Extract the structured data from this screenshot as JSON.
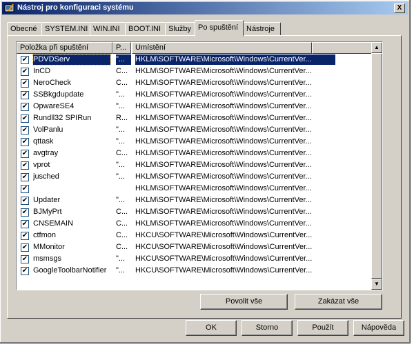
{
  "window": {
    "title": "Nástroj pro konfiguraci systému",
    "close_label": "X"
  },
  "tabs": [
    "Obecné",
    "SYSTEM.INI",
    "WIN.INI",
    "BOOT.INI",
    "Služby",
    "Po spuštění",
    "Nástroje"
  ],
  "active_tab": 5,
  "listview": {
    "headers": {
      "item": "Položka při spuštění",
      "command": "P...",
      "location": "Umístění"
    },
    "rows": [
      {
        "name": "PDVDServ",
        "command": "\"...",
        "location": "HKLM\\SOFTWARE\\Microsoft\\Windows\\CurrentVer...",
        "checked": true,
        "selected": true
      },
      {
        "name": "InCD",
        "command": "C...",
        "location": "HKLM\\SOFTWARE\\Microsoft\\Windows\\CurrentVer...",
        "checked": true
      },
      {
        "name": "NeroCheck",
        "command": "C...",
        "location": "HKLM\\SOFTWARE\\Microsoft\\Windows\\CurrentVer...",
        "checked": true
      },
      {
        "name": "SSBkgdupdate",
        "command": "\"...",
        "location": "HKLM\\SOFTWARE\\Microsoft\\Windows\\CurrentVer...",
        "checked": true
      },
      {
        "name": "OpwareSE4",
        "command": "\"...",
        "location": "HKLM\\SOFTWARE\\Microsoft\\Windows\\CurrentVer...",
        "checked": true
      },
      {
        "name": "Rundll32 SPIRun",
        "command": "R...",
        "location": "HKLM\\SOFTWARE\\Microsoft\\Windows\\CurrentVer...",
        "checked": true
      },
      {
        "name": "VolPanlu",
        "command": "\"...",
        "location": "HKLM\\SOFTWARE\\Microsoft\\Windows\\CurrentVer...",
        "checked": true
      },
      {
        "name": "qttask",
        "command": "\"...",
        "location": "HKLM\\SOFTWARE\\Microsoft\\Windows\\CurrentVer...",
        "checked": true
      },
      {
        "name": "avgtray",
        "command": "C...",
        "location": "HKLM\\SOFTWARE\\Microsoft\\Windows\\CurrentVer...",
        "checked": true
      },
      {
        "name": "vprot",
        "command": "\"...",
        "location": "HKLM\\SOFTWARE\\Microsoft\\Windows\\CurrentVer...",
        "checked": true
      },
      {
        "name": "jusched",
        "command": "\"...",
        "location": "HKLM\\SOFTWARE\\Microsoft\\Windows\\CurrentVer...",
        "checked": true
      },
      {
        "name": "",
        "command": "",
        "location": "HKLM\\SOFTWARE\\Microsoft\\Windows\\CurrentVer...",
        "checked": true
      },
      {
        "name": "Updater",
        "command": "\"...",
        "location": "HKLM\\SOFTWARE\\Microsoft\\Windows\\CurrentVer...",
        "checked": true
      },
      {
        "name": "BJMyPrt",
        "command": "C...",
        "location": "HKLM\\SOFTWARE\\Microsoft\\Windows\\CurrentVer...",
        "checked": true
      },
      {
        "name": "CNSEMAIN",
        "command": "C...",
        "location": "HKLM\\SOFTWARE\\Microsoft\\Windows\\CurrentVer...",
        "checked": true
      },
      {
        "name": "ctfmon",
        "command": "C...",
        "location": "HKCU\\SOFTWARE\\Microsoft\\Windows\\CurrentVer...",
        "checked": true
      },
      {
        "name": "MMonitor",
        "command": "C...",
        "location": "HKCU\\SOFTWARE\\Microsoft\\Windows\\CurrentVer...",
        "checked": true
      },
      {
        "name": "msmsgs",
        "command": "\"...",
        "location": "HKCU\\SOFTWARE\\Microsoft\\Windows\\CurrentVer...",
        "checked": true
      },
      {
        "name": "GoogleToolbarNotifier",
        "command": "\"...",
        "location": "HKCU\\SOFTWARE\\Microsoft\\Windows\\CurrentVer...",
        "checked": true
      }
    ]
  },
  "buttons": {
    "enable_all": "Povolit vše",
    "disable_all": "Zakázat vše",
    "ok": "OK",
    "cancel": "Storno",
    "apply": "Použít",
    "help": "Nápověda"
  },
  "colors": {
    "titlebar": "#0a246a",
    "selection": "#0a246a",
    "face": "#d4d0c8"
  }
}
